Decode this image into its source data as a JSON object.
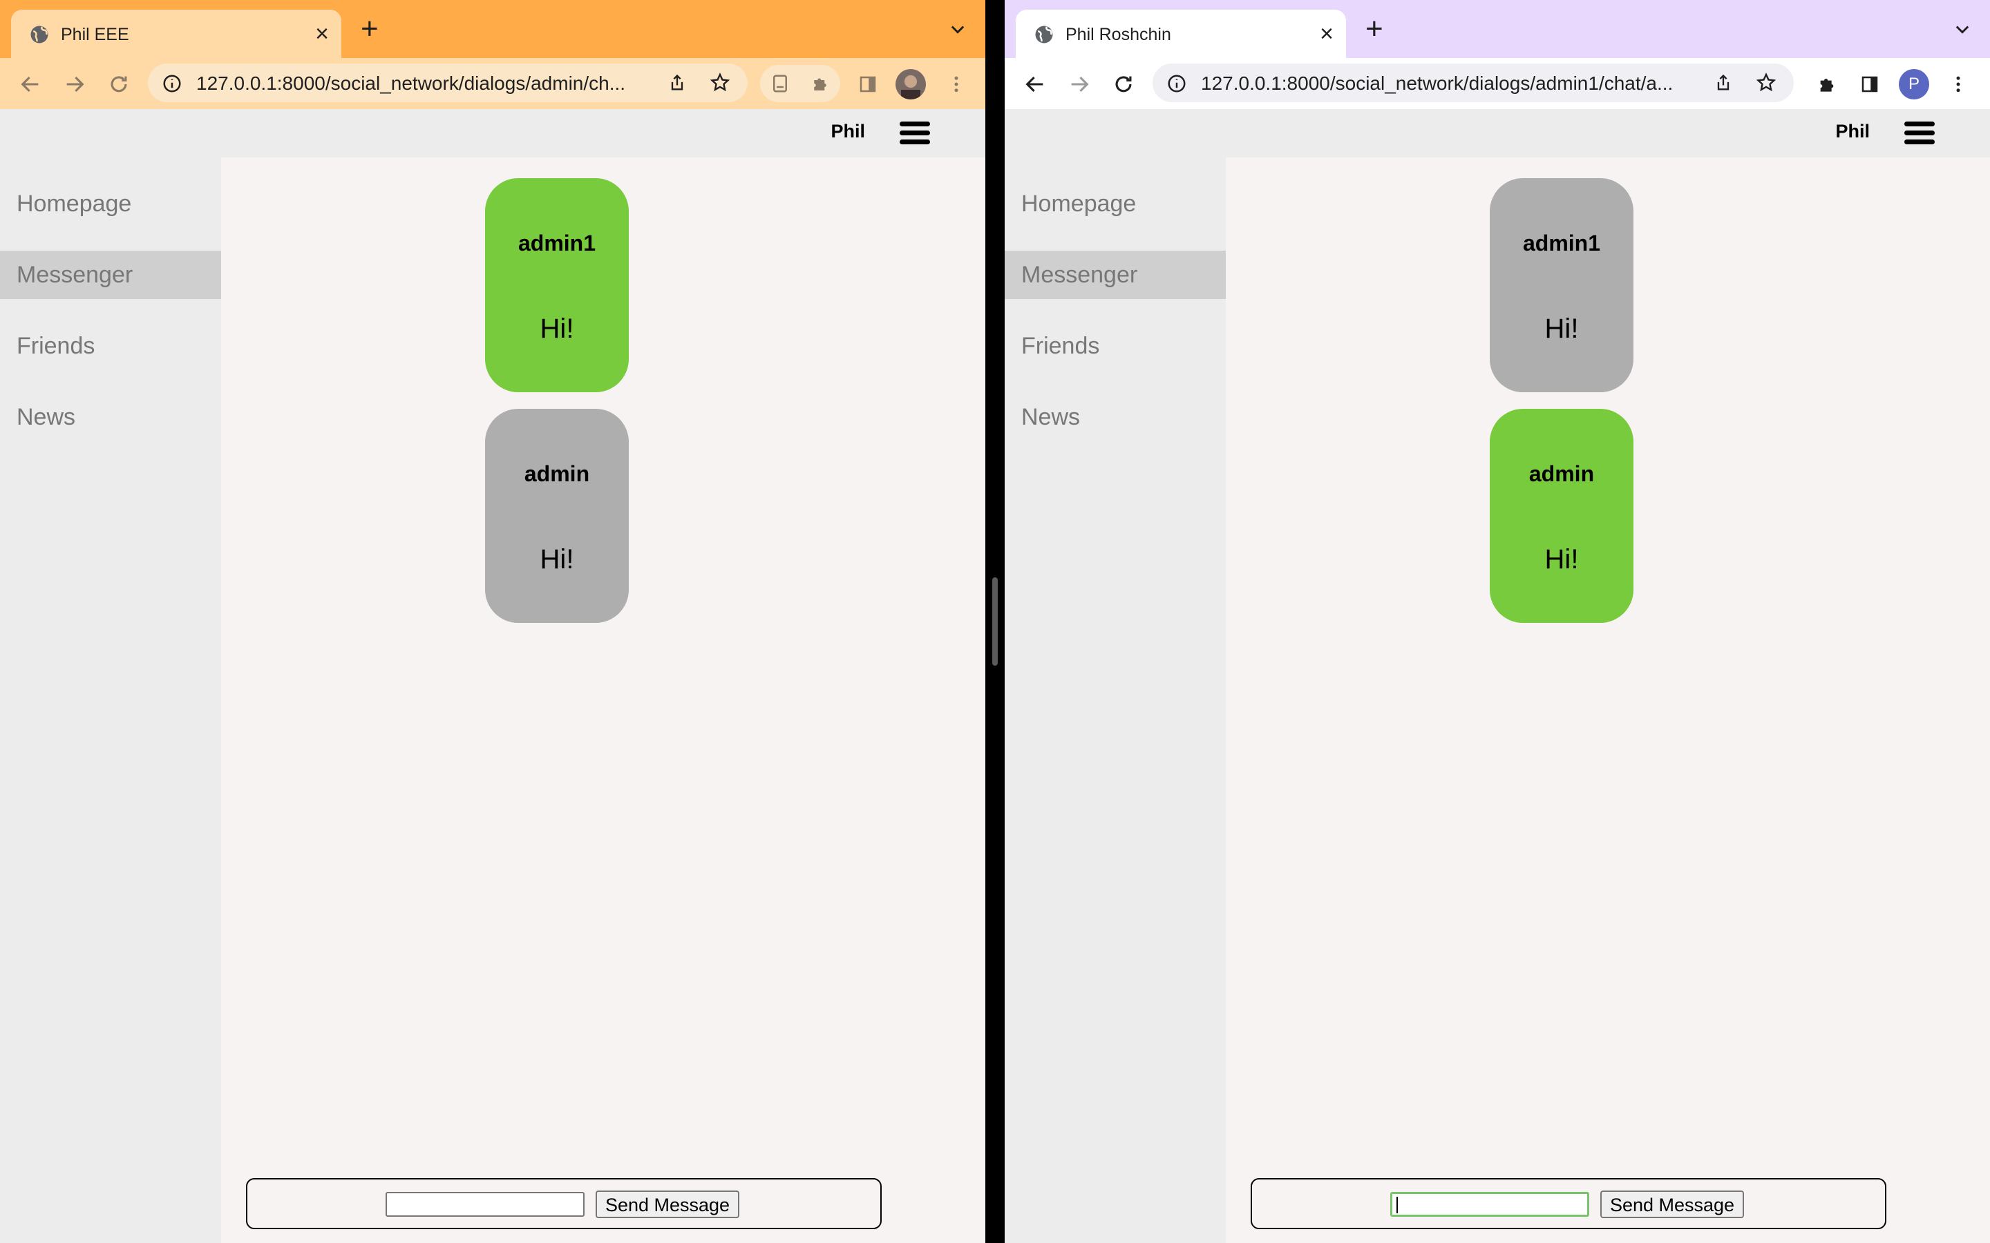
{
  "left_window": {
    "tab_title": "Phil EEE",
    "url": "127.0.0.1:8000/social_network/dialogs/admin/ch...",
    "header_user": "Phil",
    "sidebar": [
      "Homepage",
      "Messenger",
      "Friends",
      "News"
    ],
    "active_nav": "Messenger",
    "messages": [
      {
        "author": "admin1",
        "text": "Hi!",
        "color": "#77cb3d"
      },
      {
        "author": "admin",
        "text": "Hi!",
        "color": "#aeaeae"
      }
    ],
    "input_value": "",
    "send_label": "Send Message"
  },
  "right_window": {
    "tab_title": "Phil Roshchin",
    "url": "127.0.0.1:8000/social_network/dialogs/admin1/chat/a...",
    "header_user": "Phil",
    "profile_initial": "P",
    "sidebar": [
      "Homepage",
      "Messenger",
      "Friends",
      "News"
    ],
    "active_nav": "Messenger",
    "messages": [
      {
        "author": "admin1",
        "text": "Hi!",
        "color": "#aeaeae"
      },
      {
        "author": "admin",
        "text": "Hi!",
        "color": "#77cb3d"
      }
    ],
    "input_value": "",
    "send_label": "Send Message"
  },
  "theme": {
    "left_frame": "#ffab47",
    "right_frame": "#e8d8fd",
    "sent_bubble": "#77cb3d",
    "received_bubble": "#aeaeae"
  }
}
